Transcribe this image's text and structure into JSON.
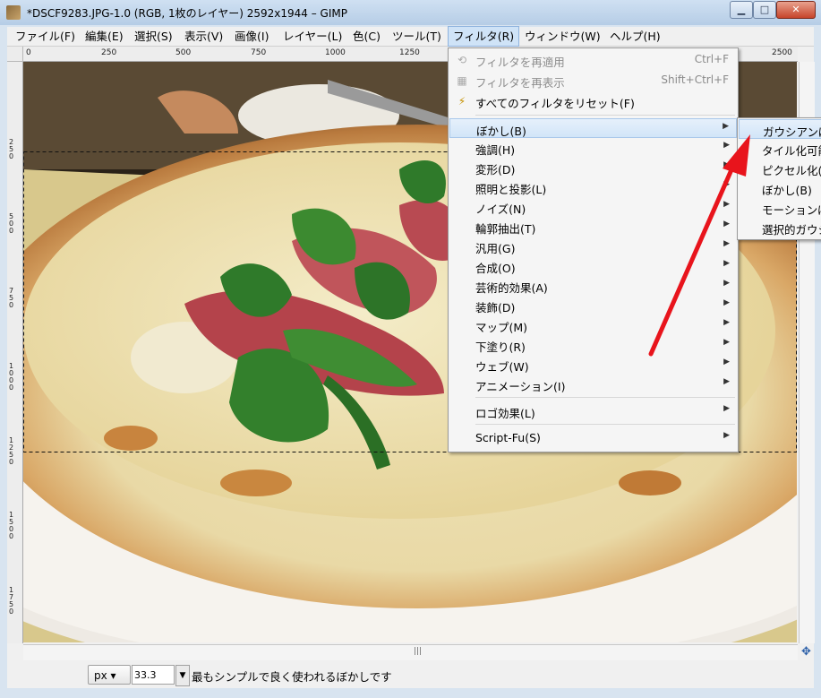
{
  "window": {
    "title": "*DSCF9283.JPG-1.0 (RGB, 1枚のレイヤー) 2592x1944 – GIMP",
    "min_glyph": "▁",
    "max_glyph": "□",
    "close_glyph": "✕"
  },
  "menubar": [
    {
      "label": "ファイル(F)"
    },
    {
      "label": "編集(E)"
    },
    {
      "label": "選択(S)"
    },
    {
      "label": "表示(V)"
    },
    {
      "label": "画像(I)"
    },
    {
      "label": "レイヤー(L)"
    },
    {
      "label": "色(C)"
    },
    {
      "label": "ツール(T)"
    },
    {
      "label": "フィルタ(R)"
    },
    {
      "label": "ウィンドウ(W)"
    },
    {
      "label": "ヘルプ(H)"
    }
  ],
  "rulers": {
    "h_ticks": [
      "0",
      "250",
      "500",
      "750",
      "1000",
      "1250",
      "2500"
    ],
    "v_ticks": [
      "250",
      "500",
      "750",
      "1000",
      "1250",
      "1500",
      "1750"
    ]
  },
  "filters_menu": {
    "top_items": [
      {
        "label": "フィルタを再適用",
        "shortcut": "Ctrl+F",
        "disabled": true,
        "icon": "reapply-icon"
      },
      {
        "label": "フィルタを再表示",
        "shortcut": "Shift+Ctrl+F",
        "disabled": true,
        "icon": "reshow-icon"
      },
      {
        "label": "すべてのフィルタをリセット(F)",
        "shortcut": "",
        "disabled": false,
        "icon": "reset-icon"
      }
    ],
    "groups": [
      {
        "label": "ぼかし(B)"
      },
      {
        "label": "強調(H)"
      },
      {
        "label": "変形(D)"
      },
      {
        "label": "照明と投影(L)"
      },
      {
        "label": "ノイズ(N)"
      },
      {
        "label": "輪郭抽出(T)"
      },
      {
        "label": "汎用(G)"
      },
      {
        "label": "合成(O)"
      },
      {
        "label": "芸術的効果(A)"
      },
      {
        "label": "装飾(D)"
      },
      {
        "label": "マップ(M)"
      },
      {
        "label": "下塗り(R)"
      },
      {
        "label": "ウェブ(W)"
      },
      {
        "label": "アニメーション(I)"
      }
    ],
    "logo": {
      "label": "ロゴ効果(L)"
    },
    "script": {
      "label": "Script-Fu(S)"
    }
  },
  "blur_submenu": [
    {
      "label": "ガウシアンぼかし"
    },
    {
      "label": "タイル化可能ぼかし"
    },
    {
      "label": "ピクセル化(P)"
    },
    {
      "label": "ぼかし(B)"
    },
    {
      "label": "モーションぼかし"
    },
    {
      "label": "選択的ガウシアンぼかし"
    }
  ],
  "statusbar": {
    "unit": "px",
    "zoom": "33.3",
    "message": "最もシンプルで良く使われるぼかしです"
  },
  "colors": {
    "annotation_arrow": "#e8141c",
    "menu_highlight": "#d2e5f8"
  }
}
